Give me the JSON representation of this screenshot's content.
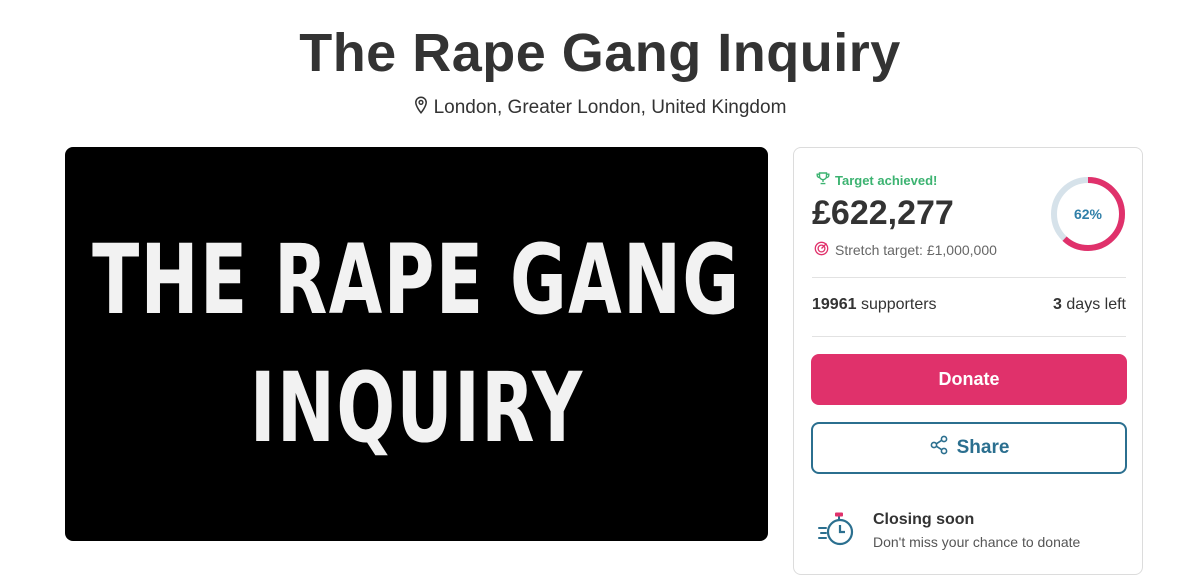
{
  "header": {
    "title": "The Rape Gang Inquiry",
    "location": "London, Greater London, United Kingdom"
  },
  "hero": {
    "line1": "THE RAPE GANG",
    "line2": "INQUIRY"
  },
  "funding": {
    "target_status": "Target achieved!",
    "amount_raised": "£622,277",
    "stretch_target": "Stretch target: £1,000,000",
    "progress_label": "62%",
    "progress_fraction": 0.62,
    "supporters_count": "19961",
    "supporters_label": "supporters",
    "days_count": "3",
    "days_label": "days left",
    "donate_label": "Donate",
    "share_label": "Share",
    "closing_title": "Closing soon",
    "closing_subtitle": "Don't miss your chance to donate"
  },
  "colors": {
    "accent_pink": "#e0316b",
    "share_teal": "#2b6f8f",
    "success_green": "#3cb371",
    "ring_track": "#d6e2ea"
  },
  "icons": [
    "map-pin-icon",
    "trophy-icon",
    "target-icon",
    "share-icon",
    "stopwatch-icon"
  ]
}
